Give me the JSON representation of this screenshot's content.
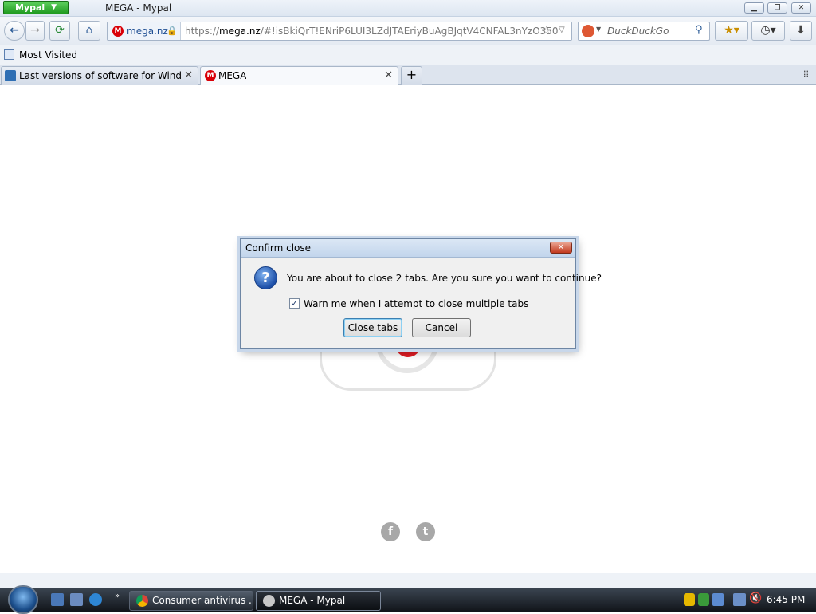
{
  "window": {
    "app_menu": "Mypal",
    "title": "MEGA - Mypal"
  },
  "navbar": {
    "site_identity": "mega.nz",
    "url_prefix": "https://",
    "url_host": "mega.nz",
    "url_path": "/#!isBkiQrT!ENriP6LUI3LZdJTAEriyBuAgBJqtV4CNFAL3nYzO350",
    "search_placeholder": "DuckDuckGo"
  },
  "bookmarks": {
    "most_visited": "Most Visited"
  },
  "tabs": [
    {
      "label": "Last versions of software for Window..."
    },
    {
      "label": "MEGA"
    }
  ],
  "dialog": {
    "title": "Confirm close",
    "message": "You are about to close 2 tabs. Are you sure you want to continue?",
    "checkbox_label": "Warn me when I attempt to close multiple tabs",
    "checkbox_checked": true,
    "ok_label": "Close tabs",
    "cancel_label": "Cancel"
  },
  "taskbar": {
    "items": [
      {
        "label": "Consumer antivirus ..."
      },
      {
        "label": "MEGA - Mypal"
      }
    ],
    "clock": "6:45 PM"
  },
  "colors": {
    "mega_red": "#d90007",
    "app_menu_green": "#2aa52a"
  }
}
